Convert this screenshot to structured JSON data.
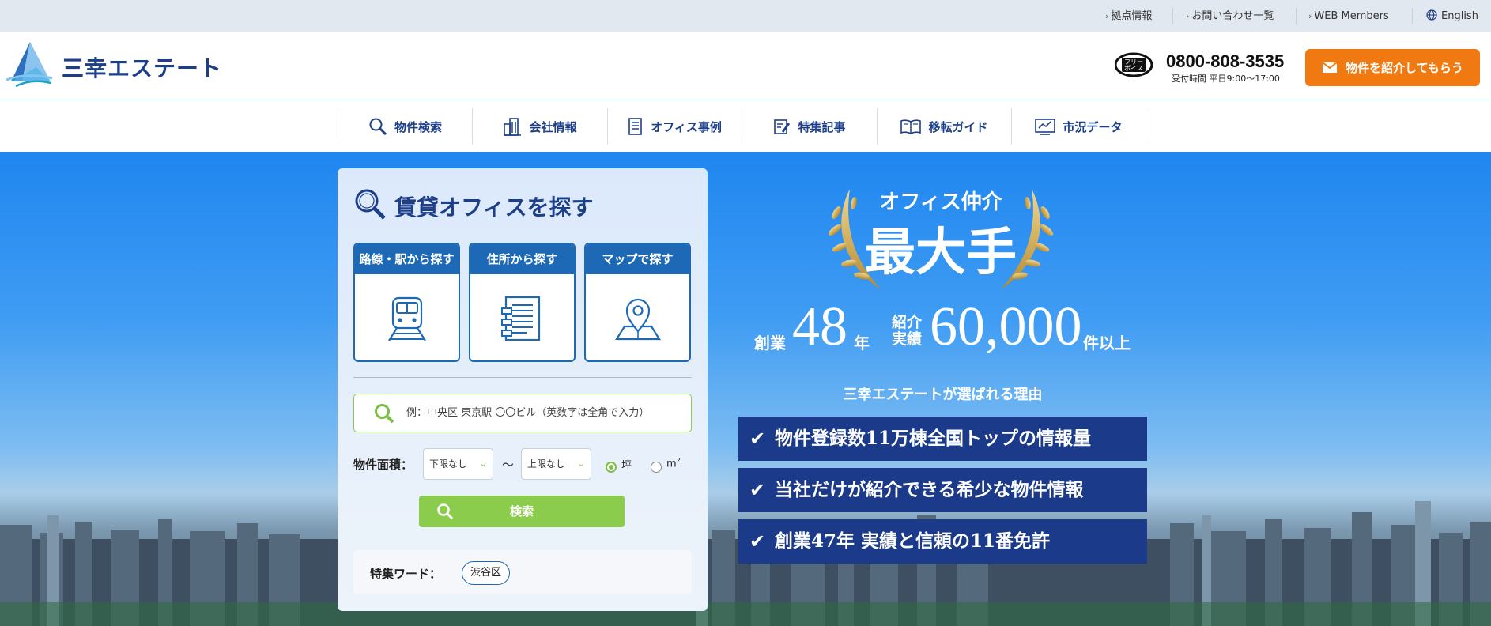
{
  "util_links": [
    {
      "label": "拠点情報"
    },
    {
      "label": "お問い合わせ一覧"
    },
    {
      "label": "WEB Members"
    }
  ],
  "language": {
    "label": "English",
    "icon": "globe-icon"
  },
  "logo": {
    "text": "三幸エステート"
  },
  "contact": {
    "freedial_badge": [
      "フリー",
      "ボイス"
    ],
    "phone": "0800-808-3535",
    "hours": "受付時間 平日9:00〜17:00",
    "cta_label": "物件を紹介してもらう",
    "cta_icon": "mail-icon"
  },
  "nav": [
    {
      "label": "物件検索",
      "icon": "search-icon"
    },
    {
      "label": "会社情報",
      "icon": "building-icon"
    },
    {
      "label": "オフィス事例",
      "icon": "document-icon"
    },
    {
      "label": "特集記事",
      "icon": "edit-note-icon"
    },
    {
      "label": "移転ガイド",
      "icon": "book-icon"
    },
    {
      "label": "市況データ",
      "icon": "chart-monitor-icon"
    }
  ],
  "search_panel": {
    "title": "賃貸オフィスを探す",
    "tabs": [
      {
        "label": "路線・駅から探す",
        "icon": "train-icon"
      },
      {
        "label": "住所から探す",
        "icon": "address-list-icon"
      },
      {
        "label": "マップで探す",
        "icon": "map-pin-icon"
      }
    ],
    "search_placeholder": "例：中央区 東京駅 〇〇ビル（英数字は全角で入力）",
    "area_label": "物件面積：",
    "min_select": "下限なし",
    "tilde": "〜",
    "max_select": "上限なし",
    "unit_options": [
      {
        "label": "坪",
        "selected": true
      },
      {
        "label": "m",
        "sup": "2",
        "selected": false
      }
    ],
    "search_button": "検索",
    "feature_label": "特集ワード：",
    "feature_chips": [
      "渋谷区"
    ]
  },
  "hero": {
    "award_sub": "オフィス仲介",
    "award_main": "最大手",
    "stat_founded_prefix": "創業",
    "stat_founded_value": "48",
    "stat_founded_suffix": "年",
    "stat_intro_label_1": "紹介",
    "stat_intro_label_2": "実績",
    "stat_intro_value": "60,000",
    "stat_intro_suffix": "件以上",
    "reason_title": "三幸エステートが選ばれる理由",
    "reasons": [
      "物件登録数11万棟全国トップの情報量",
      "当社だけが紹介できる希少な物件情報",
      "創業47年 実績と信頼の11番免許"
    ]
  },
  "colors": {
    "brand_navy": "#1d3f8a",
    "accent_orange": "#f07a11",
    "accent_green": "#8ccc4c",
    "tab_blue": "#1e69b6",
    "reason_navy": "#1b3a8a"
  }
}
